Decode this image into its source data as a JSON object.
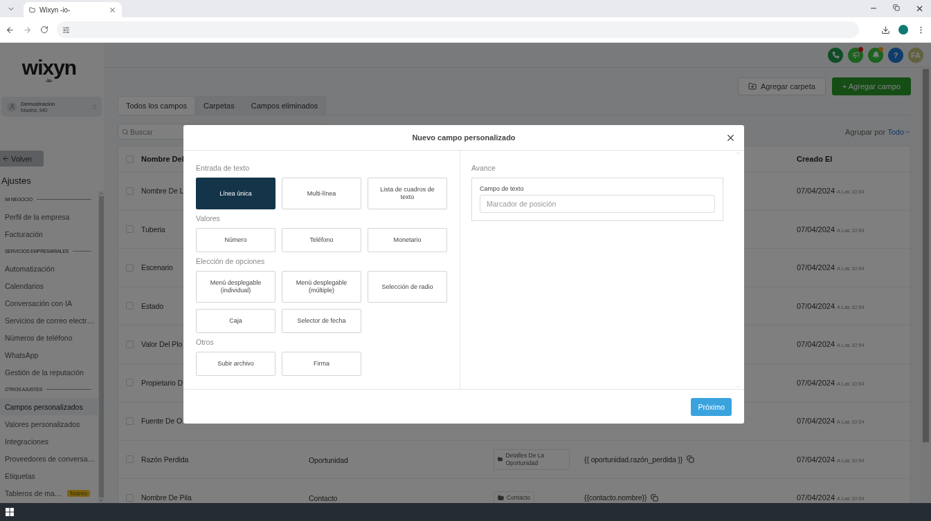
{
  "browser": {
    "tab_title": "Wixyn -io-"
  },
  "sidebar": {
    "logo": {
      "name": "wixyn",
      "sub": "-io-"
    },
    "account": {
      "name": "Demostración",
      "location": "Madrid, MD"
    },
    "back_label": "Volver",
    "title": "Ajustes",
    "sections": [
      {
        "heading": "MI NEGOCIO",
        "items": [
          {
            "label": "Perfil de la empresa",
            "selected": false
          },
          {
            "label": "Facturación",
            "selected": false
          }
        ]
      },
      {
        "heading": "SERVICIOS EMPRESARIALES",
        "items": [
          {
            "label": "Automatización",
            "selected": false
          },
          {
            "label": "Calendarios",
            "selected": false
          },
          {
            "label": "Conversación con IA",
            "selected": false
          },
          {
            "label": "Servicios de correo electr…",
            "selected": false
          },
          {
            "label": "Números de teléfono",
            "selected": false
          },
          {
            "label": "WhatsApp",
            "selected": false
          },
          {
            "label": "Gestión de la reputación",
            "selected": false
          }
        ]
      },
      {
        "heading": "OTROS AJUSTES",
        "items": [
          {
            "label": "Campos personalizados",
            "selected": true
          },
          {
            "label": "Valores personalizados",
            "selected": false
          },
          {
            "label": "Integraciones",
            "selected": false
          },
          {
            "label": "Proveedores de conversa…",
            "selected": false
          },
          {
            "label": "Etiquetas",
            "selected": false
          },
          {
            "label": "Tableros de ma…",
            "selected": false,
            "badge": "Nuevo"
          }
        ]
      }
    ]
  },
  "header": {
    "icons": [
      {
        "kind": "phone",
        "alert": false
      },
      {
        "kind": "megaphone",
        "alert": true
      },
      {
        "kind": "bell",
        "alert": true
      },
      {
        "kind": "help",
        "label": "?",
        "alert": false
      },
      {
        "kind": "avatar",
        "label": "FA",
        "alert": false
      }
    ]
  },
  "actions": [
    {
      "kind": "secondary",
      "label": "Agregar carpeta"
    },
    {
      "kind": "primary",
      "label": "+ Agregar campo"
    }
  ],
  "tabs": [
    {
      "label": "Todos los campos",
      "selected": true
    },
    {
      "label": "Carpetas",
      "selected": false
    },
    {
      "label": "Campos eliminados",
      "selected": false
    }
  ],
  "search": {
    "placeholder": "Buscar"
  },
  "group_by": {
    "label": "Agrupar por",
    "value": "Todo"
  },
  "table": {
    "header_checked": false,
    "columns": [
      {
        "label": "Nombre Del"
      },
      {
        "label": "Creado El"
      }
    ],
    "rows": [
      {
        "checked": false,
        "name": "Nombre De L",
        "date": "07/04/2024",
        "time": "A Las 10:54"
      },
      {
        "checked": false,
        "name": "Tuberia",
        "date": "07/04/2024",
        "time": "A Las 10:54"
      },
      {
        "checked": false,
        "name": "Escenario",
        "date": "07/04/2024",
        "time": "A Las 10:54"
      },
      {
        "checked": false,
        "name": "Estado",
        "date": "07/04/2024",
        "time": "A Las 10:54"
      },
      {
        "checked": false,
        "name": "Valor Del Plo",
        "date": "07/04/2024",
        "time": "A Las 10:54"
      },
      {
        "checked": false,
        "name": "Propietario D",
        "date": "07/04/2024",
        "time": "A Las 10:54"
      },
      {
        "checked": false,
        "name": "Fuente De O",
        "date": "07/04/2024",
        "time": "A Las 10:54"
      },
      {
        "checked": false,
        "name": "Razón Perdida",
        "object": "Oportunidad",
        "folder": "Detalles De La Oportunidad",
        "key": "{{ oportunidad.razón_perdida }}",
        "date": "07/04/2024",
        "time": "A Las 10:54"
      },
      {
        "checked": false,
        "name": "Nombre De Pila",
        "object": "Contacto",
        "folder": "Contacto",
        "key": "{{contacto.nombre}}",
        "date": "07/04/2024",
        "time": "A Las 10:54"
      }
    ]
  },
  "modal": {
    "title": "Nuevo campo personalizado",
    "sections": [
      {
        "heading": "Entrada de texto",
        "options": [
          {
            "label": "Línea única",
            "selected": true
          },
          {
            "label": "Multi-línea",
            "selected": false
          },
          {
            "label": "Lista de cuadros de texto",
            "selected": false
          }
        ]
      },
      {
        "heading": "Valores",
        "options": [
          {
            "label": "Número",
            "selected": false
          },
          {
            "label": "Teléfono",
            "selected": false
          },
          {
            "label": "Monetario",
            "selected": false
          }
        ]
      },
      {
        "heading": "Elección de opciones",
        "options": [
          {
            "label": "Menú desplegable (individual)",
            "selected": false
          },
          {
            "label": "Menú desplegable (múltiple)",
            "selected": false
          },
          {
            "label": "Selección de radio",
            "selected": false
          },
          {
            "label": "Caja",
            "selected": false
          },
          {
            "label": "Selector de fecha",
            "selected": false
          }
        ]
      },
      {
        "heading": "Otros",
        "options": [
          {
            "label": "Subir archivo",
            "selected": false
          },
          {
            "label": "Firma",
            "selected": false
          }
        ]
      }
    ],
    "preview": {
      "heading": "Avance",
      "field_label": "Campo de texto",
      "placeholder": "Marcador de posición"
    },
    "next_button": "Próximo"
  }
}
